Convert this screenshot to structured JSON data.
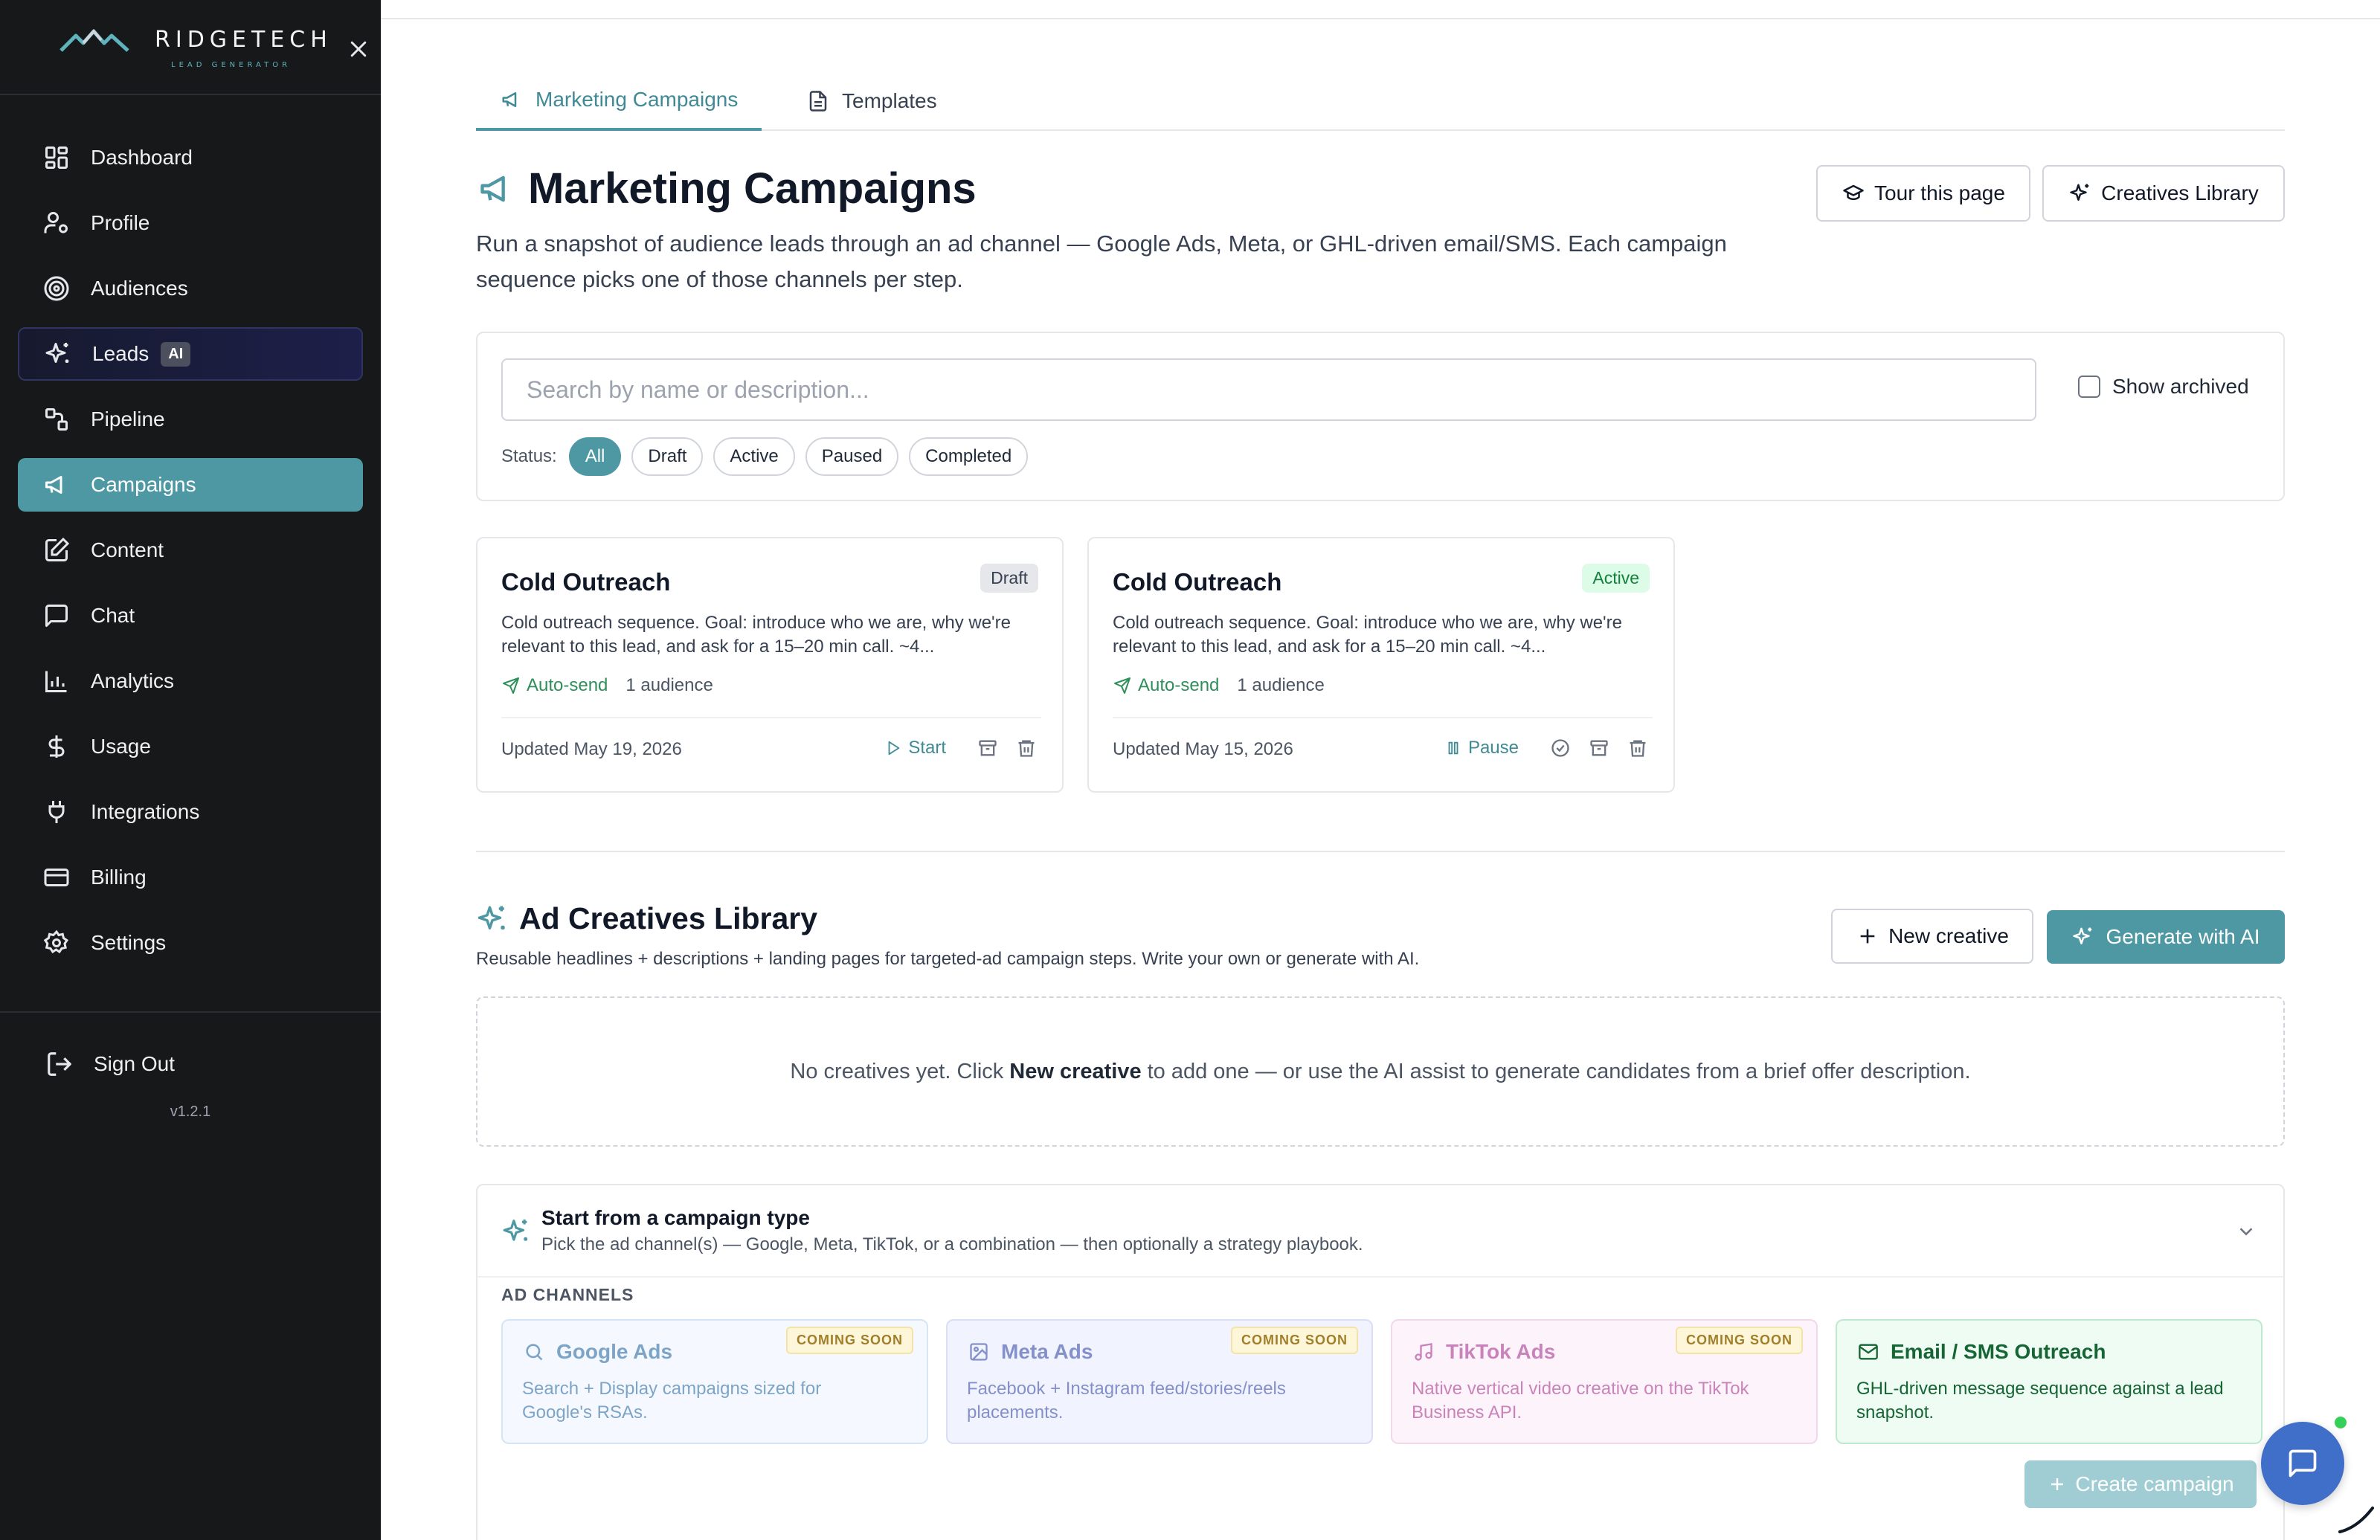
{
  "brand": {
    "name": "RIDGETECH",
    "tagline": "LEAD GENERATOR"
  },
  "sidebar": {
    "items": [
      {
        "label": "Dashboard",
        "icon": "dashboard-icon"
      },
      {
        "label": "Profile",
        "icon": "profile-icon"
      },
      {
        "label": "Audiences",
        "icon": "target-icon"
      },
      {
        "label": "Leads",
        "icon": "sparkles-icon",
        "badge": "AI"
      },
      {
        "label": "Pipeline",
        "icon": "pipeline-icon"
      },
      {
        "label": "Campaigns",
        "icon": "megaphone-icon",
        "active": true
      },
      {
        "label": "Content",
        "icon": "edit-icon"
      },
      {
        "label": "Chat",
        "icon": "chat-icon"
      },
      {
        "label": "Analytics",
        "icon": "bar-chart-icon"
      },
      {
        "label": "Usage",
        "icon": "dollar-icon"
      },
      {
        "label": "Integrations",
        "icon": "plug-icon"
      },
      {
        "label": "Billing",
        "icon": "credit-card-icon"
      },
      {
        "label": "Settings",
        "icon": "gear-icon"
      }
    ],
    "sign_out": "Sign Out",
    "version": "v1.2.1"
  },
  "tabs": [
    {
      "label": "Marketing Campaigns",
      "active": true
    },
    {
      "label": "Templates",
      "active": false
    }
  ],
  "header": {
    "title": "Marketing Campaigns",
    "description": "Run a snapshot of audience leads through an ad channel — Google Ads, Meta, or GHL-driven email/SMS. Each campaign sequence picks one of those channels per step.",
    "tour_button": "Tour this page",
    "library_button": "Creatives Library"
  },
  "filters": {
    "search_placeholder": "Search by name or description...",
    "show_archived": "Show archived",
    "status_label": "Status:",
    "statuses": [
      "All",
      "Draft",
      "Active",
      "Paused",
      "Completed"
    ],
    "selected_status": "All"
  },
  "campaigns": [
    {
      "title": "Cold Outreach",
      "status": "Draft",
      "description": "Cold outreach sequence. Goal: introduce who we are, why we're relevant to this lead, and ask for a 15–20 min call. ~4...",
      "send_mode": "Auto-send",
      "audiences": "1 audience",
      "updated": "Updated May 19, 2026",
      "primary_action": "Start"
    },
    {
      "title": "Cold Outreach",
      "status": "Active",
      "description": "Cold outreach sequence. Goal: introduce who we are, why we're relevant to this lead, and ask for a 15–20 min call. ~4...",
      "send_mode": "Auto-send",
      "audiences": "1 audience",
      "updated": "Updated May 15, 2026",
      "primary_action": "Pause"
    }
  ],
  "library": {
    "title": "Ad Creatives Library",
    "description": "Reusable headlines + descriptions + landing pages for targeted-ad campaign steps. Write your own or generate with AI.",
    "new_button": "New creative",
    "generate_button": "Generate with AI",
    "empty_prefix": "No creatives yet. Click",
    "empty_bold": "New creative",
    "empty_suffix": "to add one — or use the AI assist to generate candidates from a brief offer description."
  },
  "campaign_type": {
    "title": "Start from a campaign type",
    "subtitle": "Pick the ad channel(s) — Google, Meta, TikTok, or a combination — then optionally a strategy playbook.",
    "section_label": "AD CHANNELS",
    "channels": [
      {
        "name": "Google Ads",
        "icon": "search-icon",
        "description": "Search + Display campaigns sized for Google's RSAs.",
        "badge": "COMING SOON"
      },
      {
        "name": "Meta Ads",
        "icon": "image-icon",
        "description": "Facebook + Instagram feed/stories/reels placements.",
        "badge": "COMING SOON"
      },
      {
        "name": "TikTok Ads",
        "icon": "music-icon",
        "description": "Native vertical video creative on the TikTok Business API.",
        "badge": "COMING SOON"
      },
      {
        "name": "Email / SMS Outreach",
        "icon": "mail-icon",
        "description": "GHL-driven message sequence against a lead snapshot.",
        "badge": ""
      }
    ],
    "create_button": "Create campaign"
  },
  "colors": {
    "accent": "#4d98a3",
    "sidebar_bg": "#17181a",
    "success": "#15803d"
  }
}
